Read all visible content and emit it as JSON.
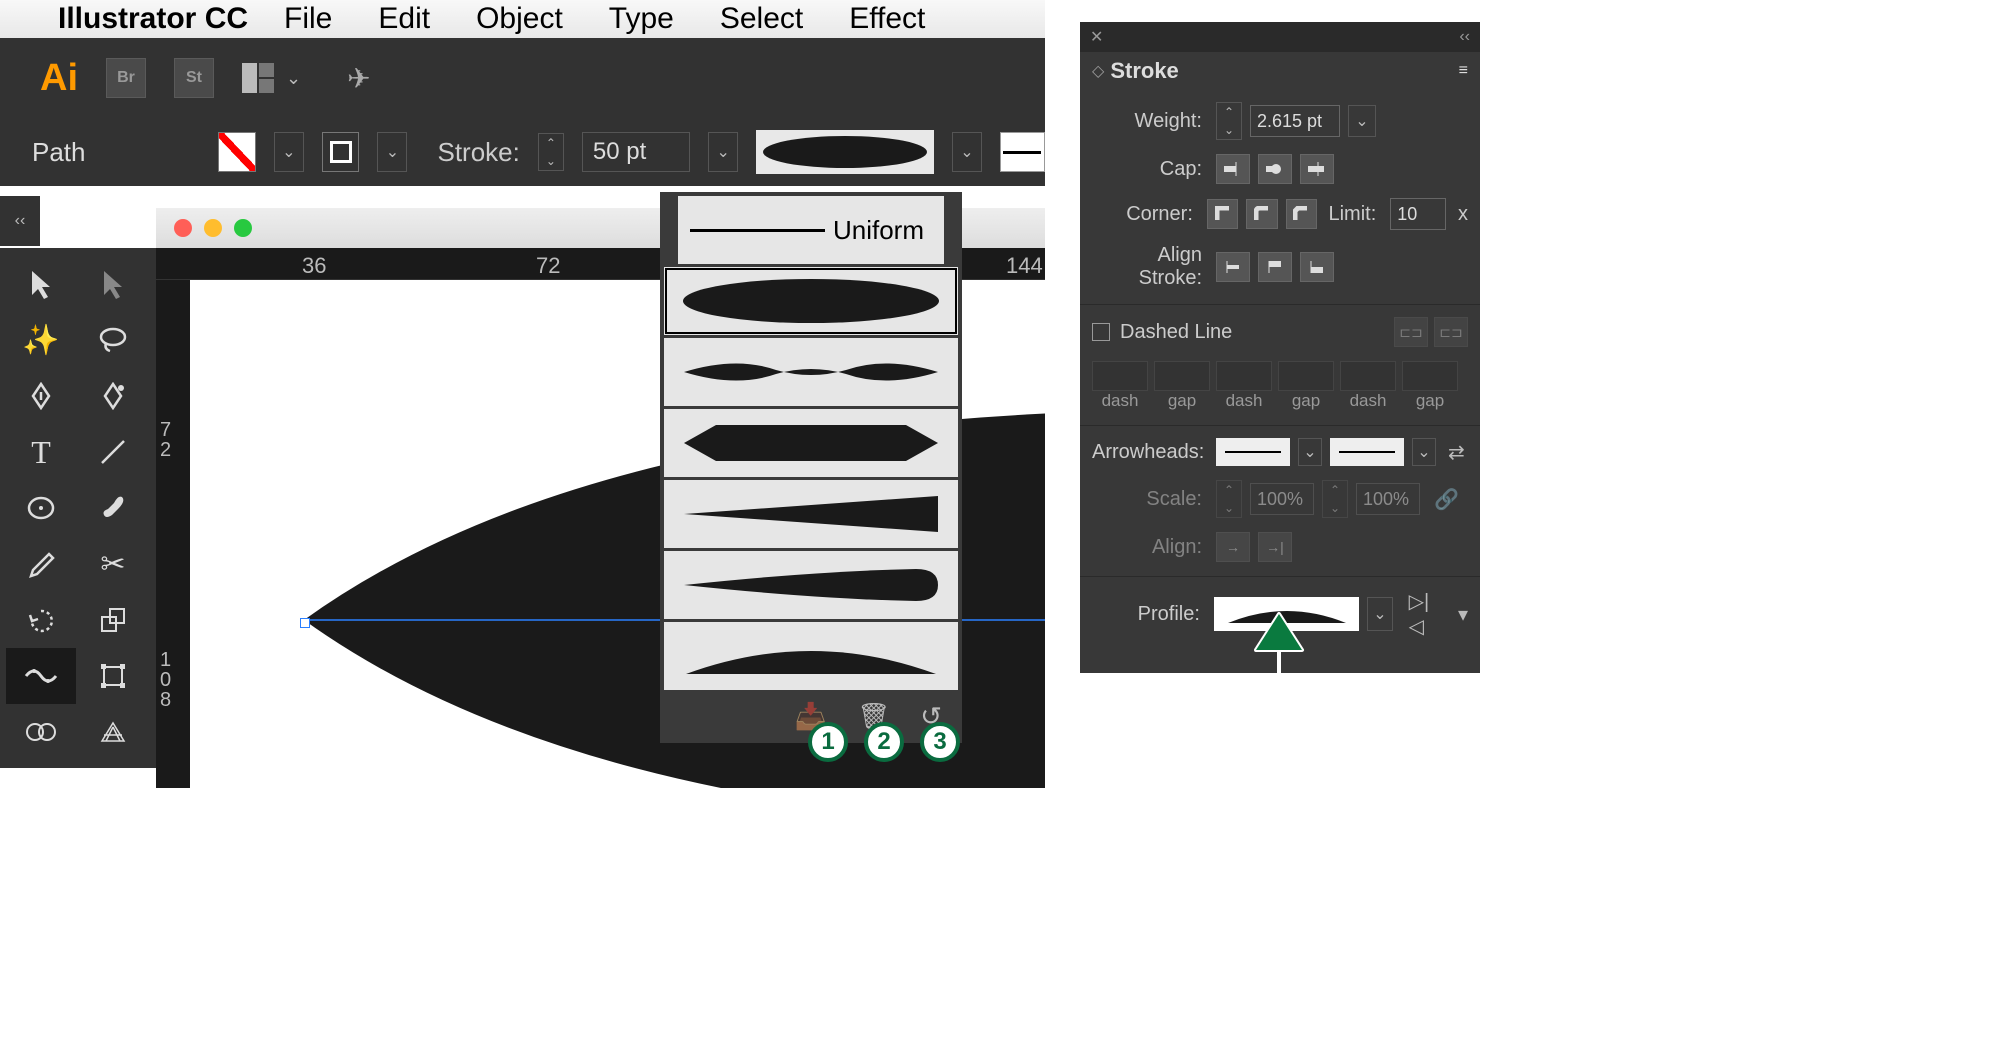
{
  "menubar": {
    "app_name": "Illustrator CC",
    "items": [
      "File",
      "Edit",
      "Object",
      "Type",
      "Select",
      "Effect"
    ]
  },
  "appbar": {
    "br": "Br",
    "st": "St"
  },
  "control": {
    "path": "Path",
    "stroke_label": "Stroke:",
    "stroke_value": "50 pt"
  },
  "ruler": {
    "h1": "36",
    "h2": "72",
    "h3": "144",
    "v1": "72",
    "v2": "108"
  },
  "profile_popup": {
    "uniform": "Uniform",
    "badges": [
      "1",
      "2",
      "3"
    ]
  },
  "stroke_panel": {
    "title": "Stroke",
    "weight_label": "Weight:",
    "weight_value": "2.615 pt",
    "cap_label": "Cap:",
    "corner_label": "Corner:",
    "limit_label": "Limit:",
    "limit_value": "10",
    "limit_x": "x",
    "align_label": "Align Stroke:",
    "dashed_label": "Dashed Line",
    "dash_labels": [
      "dash",
      "gap",
      "dash",
      "gap",
      "dash",
      "gap"
    ],
    "arrowheads_label": "Arrowheads:",
    "scale_label": "Scale:",
    "scale_value": "100%",
    "align_arr_label": "Align:",
    "profile_label": "Profile:"
  }
}
